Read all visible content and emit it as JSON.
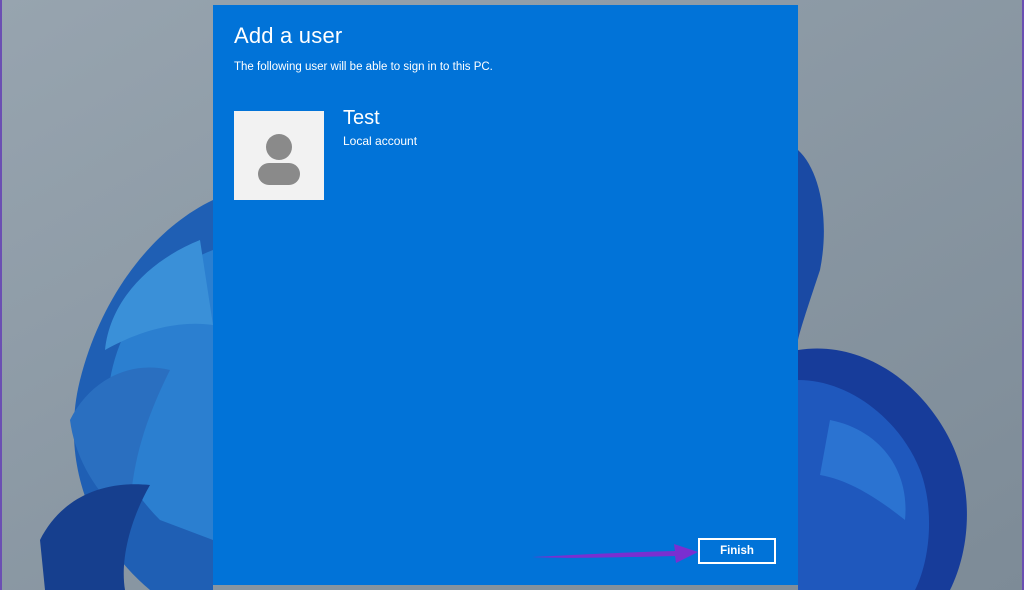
{
  "dialog": {
    "title": "Add a user",
    "subtitle": "The following user will be able to sign in to this PC.",
    "user": {
      "name": "Test",
      "account_type": "Local account",
      "avatar_icon": "user-silhouette-icon"
    },
    "finish_label": "Finish"
  },
  "annotation": {
    "arrow_icon": "pointer-arrow-icon",
    "color": "#7a2fd0"
  },
  "colors": {
    "dialog_bg": "#0173d8",
    "text": "#ffffff",
    "avatar_bg": "#f2f2f2",
    "avatar_glyph": "#8a8a8a"
  }
}
